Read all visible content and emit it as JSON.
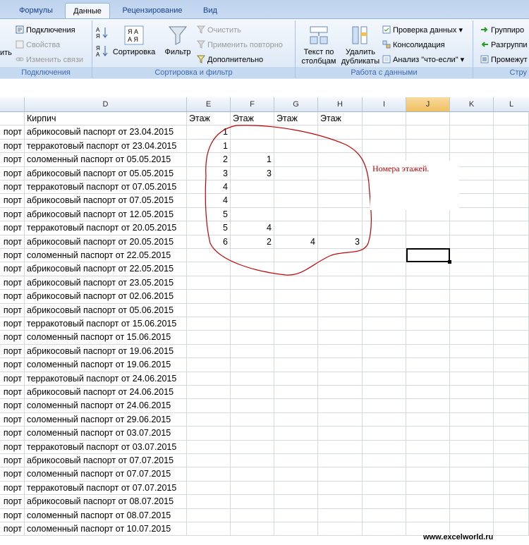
{
  "ribbon": {
    "tabs": [
      "Формулы",
      "Данные",
      "Рецензирование",
      "Вид"
    ],
    "active_tab": "Данные",
    "groups": {
      "connections": {
        "label": "Подключения",
        "cut_left": "ить",
        "items": [
          "Подключения",
          "Свойства",
          "Изменить связи"
        ]
      },
      "sort_filter": {
        "label": "Сортировка и фильтр",
        "sort_label": "Сортировка",
        "filter_label": "Фильтр",
        "clear_label": "Очистить",
        "reapply_label": "Применить повторно",
        "advanced_label": "Дополнительно"
      },
      "data_tools": {
        "label": "Работа с данными",
        "text_to_columns_1": "Текст по",
        "text_to_columns_2": "столбцам",
        "remove_dup_1": "Удалить",
        "remove_dup_2": "дубликаты",
        "validation_label": "Проверка данных",
        "consolidate_label": "Консолидация",
        "whatif_label": "Анализ \"что-если\""
      },
      "outline": {
        "label": "Стру",
        "group_label": "Группиро",
        "ungroup_label": "Разгруппи",
        "subtotal_label": "Промежут"
      }
    }
  },
  "sheet": {
    "columns": [
      "",
      "D",
      "E",
      "F",
      "G",
      "H",
      "I",
      "J",
      "K",
      "L"
    ],
    "selected_column": "J",
    "header_row": {
      "col_c": "",
      "col_d": "Кирпич",
      "col_e": "Этаж",
      "col_f": "Этаж",
      "col_g": "Этаж",
      "col_h": "Этаж"
    },
    "rows": [
      {
        "c": "порт",
        "d": "абрикосовый паспорт от 23.04.2015",
        "e": "1",
        "f": "",
        "g": "",
        "h": ""
      },
      {
        "c": "порт",
        "d": "терракотовый паспорт от 23.04.2015",
        "e": "1",
        "f": "",
        "g": "",
        "h": ""
      },
      {
        "c": "порт",
        "d": "соломенный паспорт от 05.05.2015",
        "e": "2",
        "f": "1",
        "g": "",
        "h": ""
      },
      {
        "c": "порт",
        "d": "абрикосовый паспорт от 05.05.2015",
        "e": "3",
        "f": "3",
        "g": "",
        "h": ""
      },
      {
        "c": "порт",
        "d": "терракотовый паспорт от 07.05.2015",
        "e": "4",
        "f": "",
        "g": "",
        "h": ""
      },
      {
        "c": "порт",
        "d": "абрикосовый паспорт от 07.05.2015",
        "e": "4",
        "f": "",
        "g": "",
        "h": ""
      },
      {
        "c": "порт",
        "d": "абрикосовый паспорт от 12.05.2015",
        "e": "5",
        "f": "",
        "g": "",
        "h": ""
      },
      {
        "c": "порт",
        "d": "терракотовый паспорт от 20.05.2015",
        "e": "5",
        "f": "4",
        "g": "",
        "h": ""
      },
      {
        "c": "порт",
        "d": "абрикосовый паспорт от 20.05.2015",
        "e": "6",
        "f": "2",
        "g": "4",
        "h": "3"
      },
      {
        "c": "порт",
        "d": "соломенный паспорт от 22.05.2015",
        "e": "",
        "f": "",
        "g": "",
        "h": ""
      },
      {
        "c": "порт",
        "d": "абрикосовый паспорт от 22.05.2015",
        "e": "",
        "f": "",
        "g": "",
        "h": ""
      },
      {
        "c": "порт",
        "d": "абрикосовый паспорт от 23.05.2015",
        "e": "",
        "f": "",
        "g": "",
        "h": ""
      },
      {
        "c": "порт",
        "d": "абрикосовый паспорт от 02.06.2015",
        "e": "",
        "f": "",
        "g": "",
        "h": ""
      },
      {
        "c": "порт",
        "d": "абрикосовый паспорт от 05.06.2015",
        "e": "",
        "f": "",
        "g": "",
        "h": ""
      },
      {
        "c": "порт",
        "d": "терракотовый паспорт от 15.06.2015",
        "e": "",
        "f": "",
        "g": "",
        "h": ""
      },
      {
        "c": "порт",
        "d": "соломенный паспорт от 15.06.2015",
        "e": "",
        "f": "",
        "g": "",
        "h": ""
      },
      {
        "c": "порт",
        "d": "абрикосовый паспорт от 19.06.2015",
        "e": "",
        "f": "",
        "g": "",
        "h": ""
      },
      {
        "c": "порт",
        "d": "соломенный паспорт от 19.06.2015",
        "e": "",
        "f": "",
        "g": "",
        "h": ""
      },
      {
        "c": "порт",
        "d": "терракотовый паспорт от 24.06.2015",
        "e": "",
        "f": "",
        "g": "",
        "h": ""
      },
      {
        "c": "порт",
        "d": "абрикосовый паспорт от 24.06.2015",
        "e": "",
        "f": "",
        "g": "",
        "h": ""
      },
      {
        "c": "порт",
        "d": "соломенный паспорт от 24.06.2015",
        "e": "",
        "f": "",
        "g": "",
        "h": ""
      },
      {
        "c": "порт",
        "d": "соломенный паспорт от 29.06.2015",
        "e": "",
        "f": "",
        "g": "",
        "h": ""
      },
      {
        "c": "порт",
        "d": "соломенный паспорт от 03.07.2015",
        "e": "",
        "f": "",
        "g": "",
        "h": ""
      },
      {
        "c": "порт",
        "d": "терракотовый паспорт от 03.07.2015",
        "e": "",
        "f": "",
        "g": "",
        "h": ""
      },
      {
        "c": "порт",
        "d": "абрикосовый паспорт от 07.07.2015",
        "e": "",
        "f": "",
        "g": "",
        "h": ""
      },
      {
        "c": "порт",
        "d": "соломенный паспорт от 07.07.2015",
        "e": "",
        "f": "",
        "g": "",
        "h": ""
      },
      {
        "c": "порт",
        "d": "терракотовый паспорт от 07.07.2015",
        "e": "",
        "f": "",
        "g": "",
        "h": ""
      },
      {
        "c": "порт",
        "d": "абрикосовый паспорт от 08.07.2015",
        "e": "",
        "f": "",
        "g": "",
        "h": ""
      },
      {
        "c": "порт",
        "d": "соломенный паспорт от 08.07.2015",
        "e": "",
        "f": "",
        "g": "",
        "h": ""
      },
      {
        "c": "порт",
        "d": "соломенный паспорт от 10.07.2015",
        "e": "",
        "f": "",
        "g": "",
        "h": ""
      }
    ]
  },
  "annotation": {
    "note_text": "Номера этажей.",
    "ink_color": "#c00000"
  },
  "watermark": "www.excelworld.ru"
}
